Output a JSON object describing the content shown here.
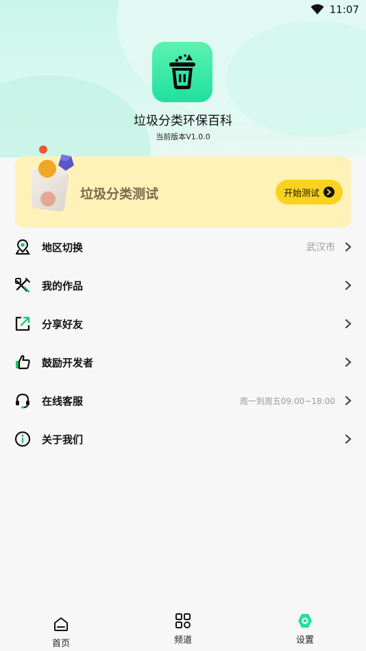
{
  "status_bar": {
    "time": "11:07",
    "wifi_icon": "wifi-icon"
  },
  "app": {
    "name": "垃圾分类环保百科",
    "version": "当前版本V1.0.0",
    "icon": "trash-can-icon"
  },
  "test_card": {
    "title": "垃圾分类测试",
    "button_label": "开始测试",
    "button_icon": "arrow-right-circle-icon"
  },
  "menu": {
    "items": [
      {
        "label": "地区切换",
        "value": "武汉市",
        "icon": "location-icon"
      },
      {
        "label": "我的作品",
        "value": "",
        "icon": "tools-icon"
      },
      {
        "label": "分享好友",
        "value": "",
        "icon": "share-icon"
      },
      {
        "label": "鼓励开发者",
        "value": "",
        "icon": "thumbs-up-icon"
      },
      {
        "label": "在线客服",
        "value": "周一到周五09:00~18:00",
        "icon": "headset-icon"
      },
      {
        "label": "关于我们",
        "value": "",
        "icon": "info-icon"
      }
    ]
  },
  "tabbar": {
    "tabs": [
      {
        "label": "首页",
        "icon": "home-icon"
      },
      {
        "label": "频道",
        "icon": "grid-icon"
      },
      {
        "label": "设置",
        "icon": "settings-icon",
        "active": true
      }
    ]
  },
  "colors": {
    "accent": "#22e0a2",
    "card_bg": "#fff2b8",
    "button": "#f8d21e"
  }
}
